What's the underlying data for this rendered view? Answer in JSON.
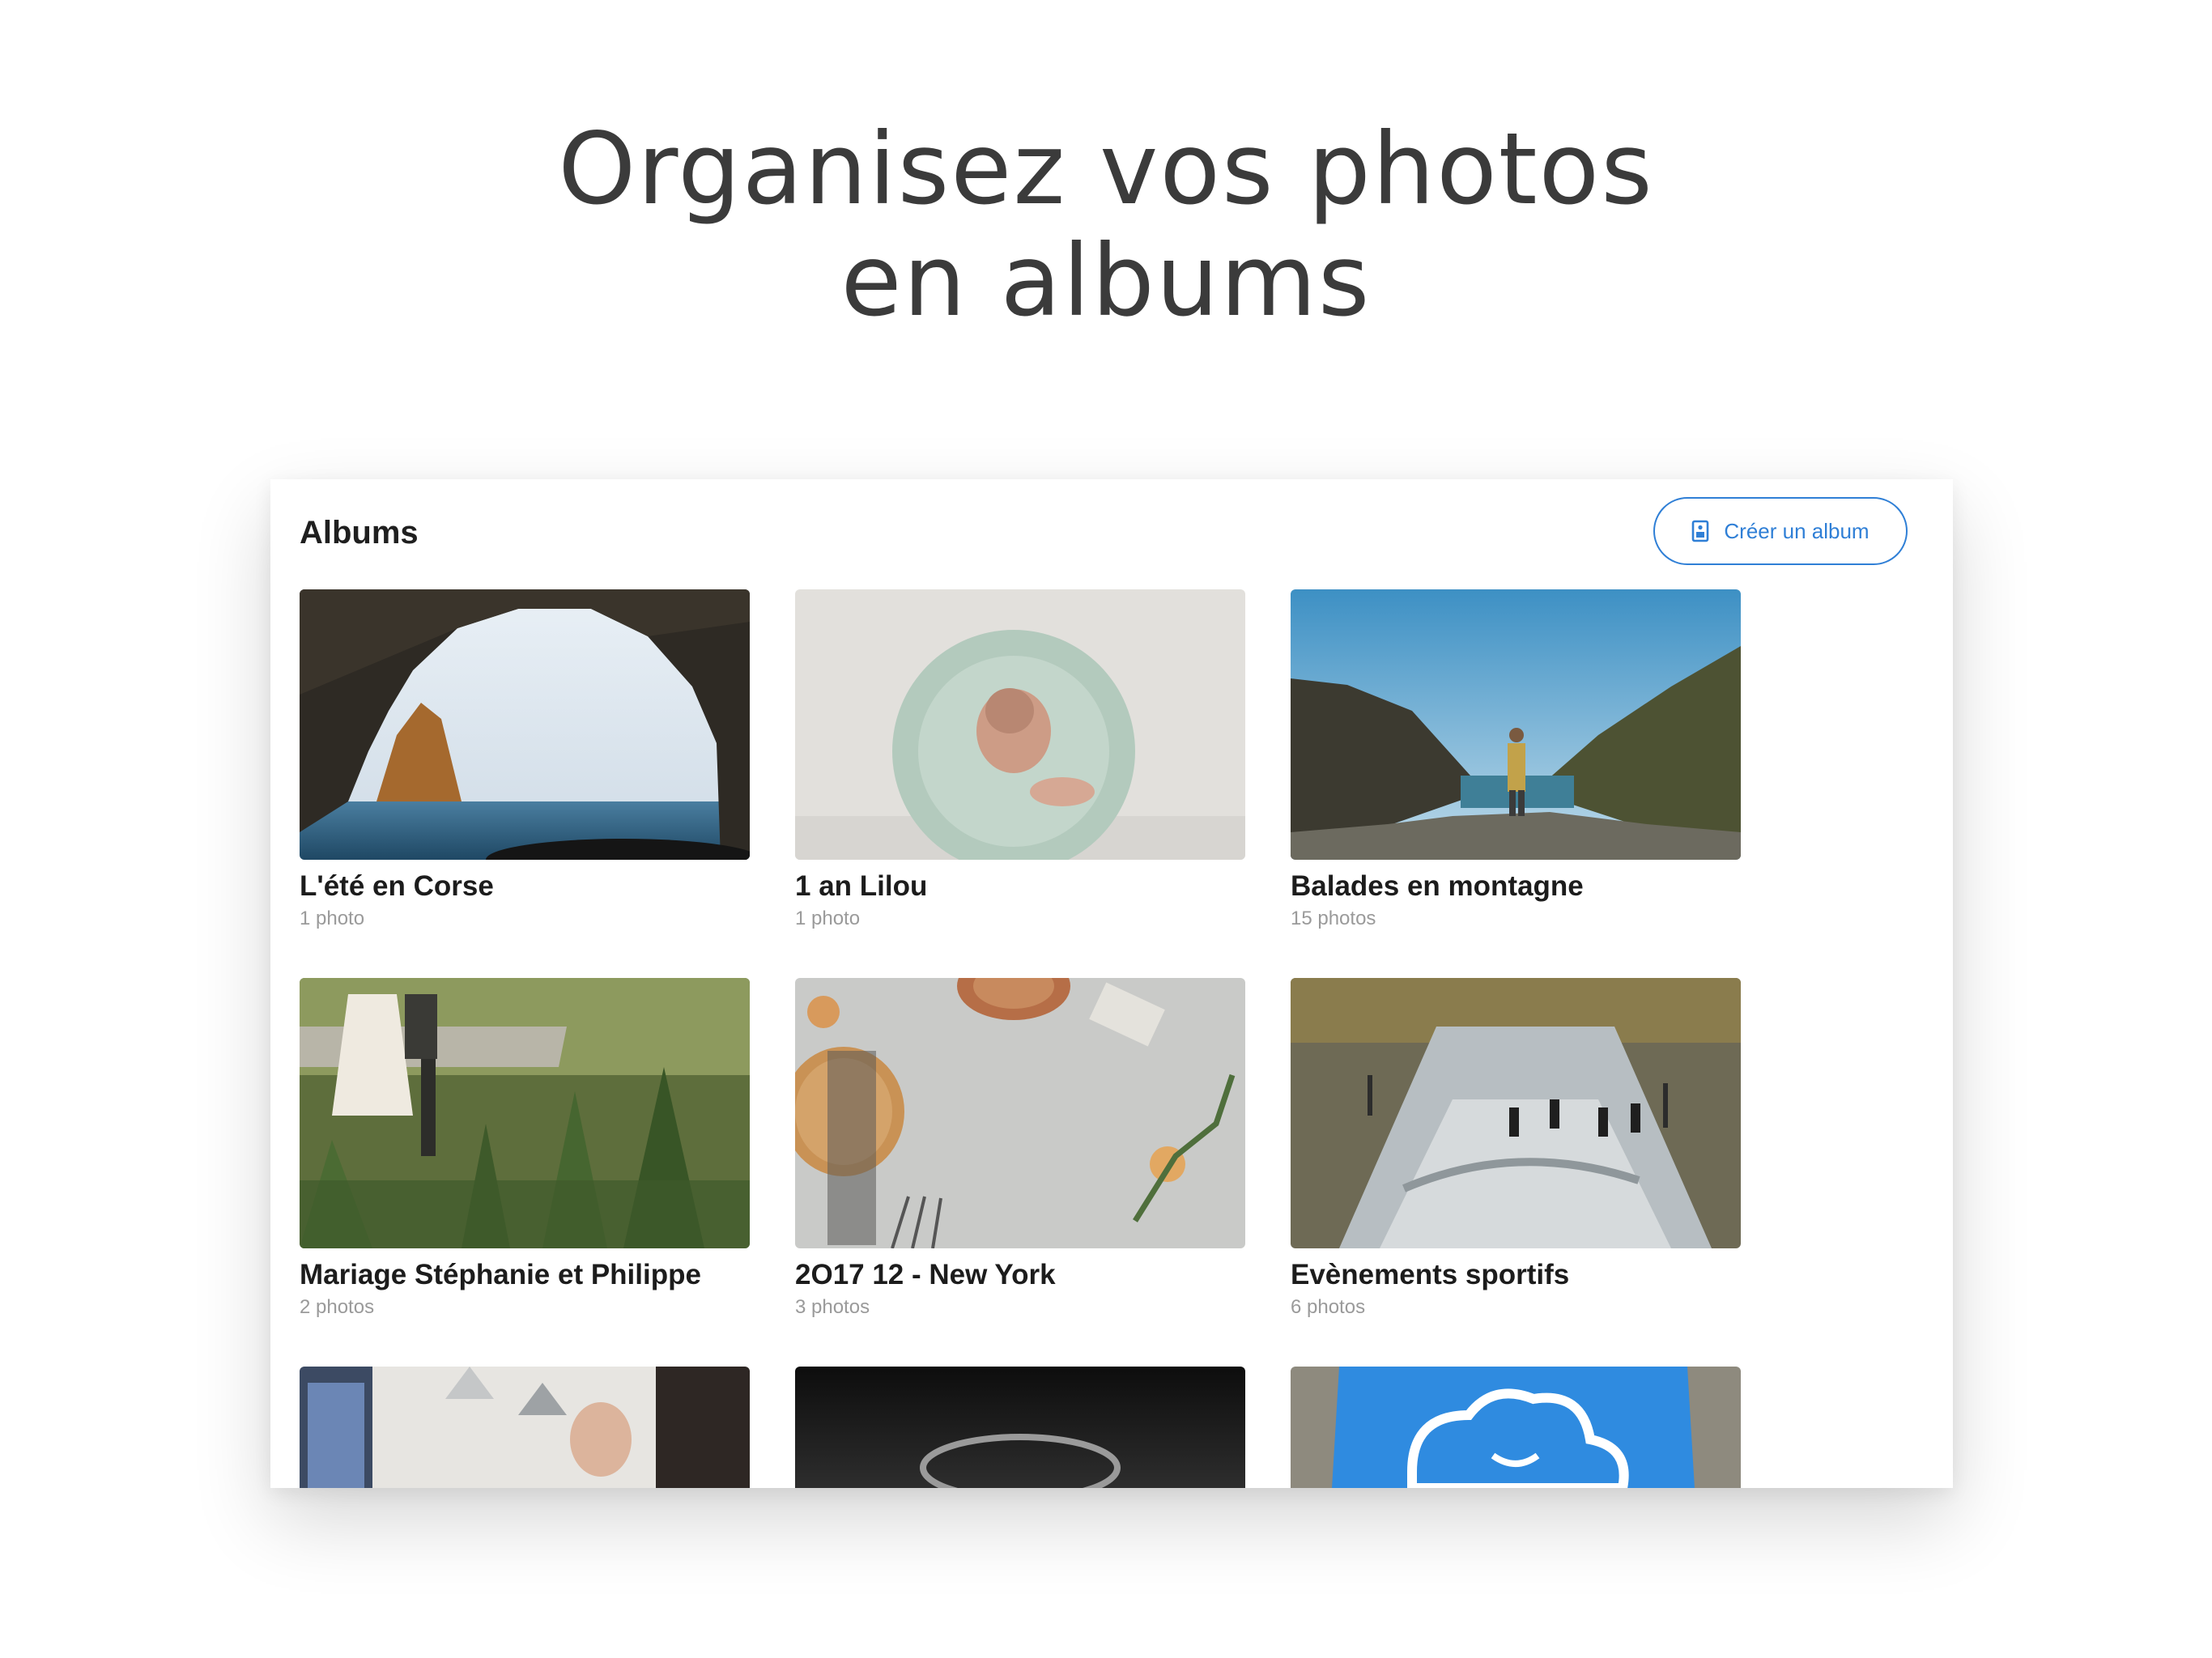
{
  "headline": {
    "line1": "Organisez vos photos",
    "line2": "en albums"
  },
  "panel": {
    "title": "Albums",
    "create_button_label": "Créer un album",
    "create_button_icon": "album-add-icon",
    "accent_color": "#2f7fd6"
  },
  "albums": [
    {
      "name": "L'été en Corse",
      "count": "1 photo",
      "thumb": "sea-cave-photo"
    },
    {
      "name": "1 an Lilou",
      "count": "1 photo",
      "thumb": "baby-photo"
    },
    {
      "name": "Balades en montagne",
      "count": "15 photos",
      "thumb": "mountain-hiker-photo"
    },
    {
      "name": "Mariage Stéphanie et Philippe",
      "count": "2 photos",
      "thumb": "wedding-couple-photo"
    },
    {
      "name": "2O17 12 - New York",
      "count": "3 photos",
      "thumb": "pie-table-photo"
    },
    {
      "name": "Evènements sportifs",
      "count": "6 photos",
      "thumb": "river-surfing-photo"
    },
    {
      "thumb": "office-presentation-photo"
    },
    {
      "thumb": "dark-ring-photo"
    },
    {
      "thumb": "blue-tshirt-photo"
    }
  ]
}
